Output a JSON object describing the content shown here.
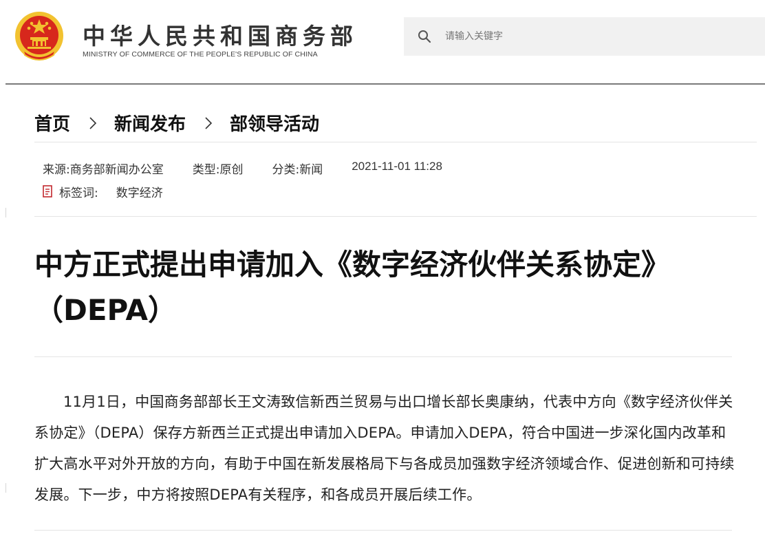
{
  "header": {
    "site_title": "中华人民共和国商务部",
    "site_subtitle": "MINISTRY OF COMMERCE OF THE PEOPLE'S REPUBLIC OF CHINA",
    "emblem_icon": "national-emblem-icon",
    "search": {
      "placeholder": "请输入关键字",
      "value": "",
      "icon": "search-icon"
    }
  },
  "breadcrumb": {
    "items": [
      {
        "label": "首页"
      },
      {
        "label": "新闻发布"
      },
      {
        "label": "部领导活动"
      }
    ],
    "separator_icon": "chevron-right-icon"
  },
  "meta": {
    "source_label": "来源:",
    "source_value": "商务部新闻办公室",
    "type_label": "类型:",
    "type_value": "原创",
    "category_label": "分类:",
    "category_value": "新闻",
    "datetime": "2021-11-01 11:28",
    "tags_icon": "tag-document-icon",
    "tags_label": "标签词:",
    "tags_value": "数字经济"
  },
  "article": {
    "title": "中方正式提出申请加入《数字经济伙伴关系协定》（DEPA）",
    "body": "11月1日，中国商务部部长王文涛致信新西兰贸易与出口增长部长奥康纳，代表中方向《数字经济伙伴关系协定》（DEPA）保存方新西兰正式提出申请加入DEPA。申请加入DEPA，符合中国进一步深化国内改革和扩大高水平对外开放的方向，有助于中国在新发展格局下与各成员加强数字经济领域合作、促进创新和可持续发展。下一步，中方将按照DEPA有关程序，和各成员开展后续工作。"
  },
  "colors": {
    "emblem_red": "#d7271c",
    "emblem_gold": "#f2c230",
    "tag_icon_red": "#c1272d",
    "search_bg": "#f1f1f1"
  }
}
